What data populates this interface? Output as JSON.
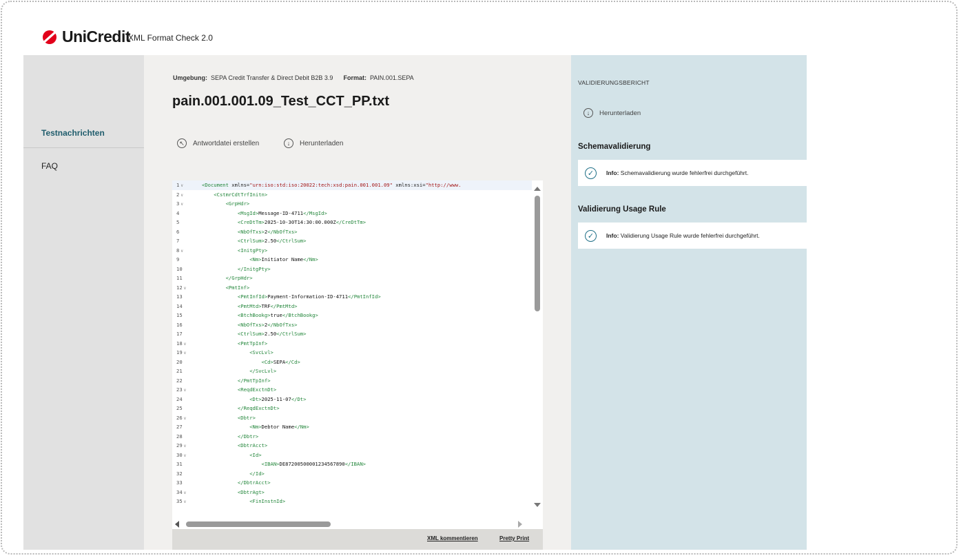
{
  "header": {
    "brand": "UniCredit",
    "app_title": "XML Format Check 2.0",
    "brand_color": "#e2001a"
  },
  "sidebar": {
    "items": [
      {
        "label": "Testnachrichten",
        "active": true
      },
      {
        "label": "FAQ",
        "active": false
      }
    ]
  },
  "main": {
    "environment_label": "Umgebung:",
    "environment_value": "SEPA Credit Transfer & Direct Debit B2B 3.9",
    "format_label": "Format:",
    "format_value": "PAIN.001.SEPA",
    "file_title": "pain.001.001.09_Test_CCT_PP.txt",
    "actions": {
      "reply_file": "Antwortdatei erstellen",
      "download": "Herunterladen"
    },
    "footer": {
      "comment": "XML kommentieren",
      "pretty_print": "Pretty Print"
    }
  },
  "editor": {
    "lines": [
      {
        "n": "1",
        "fold": true,
        "indent": 0,
        "text": "<Document xmlns=\"urn:iso:std:iso:20022:tech:xsd:pain.001.001.09\" xmlns:xsi=\"http://www."
      },
      {
        "n": "2",
        "fold": true,
        "indent": 1,
        "text": "<CstmrCdtTrfInitn>"
      },
      {
        "n": "3",
        "fold": true,
        "indent": 2,
        "text": "<GrpHdr>"
      },
      {
        "n": "4",
        "fold": false,
        "indent": 3,
        "text": "<MsgId>Message-ID-4711</MsgId>"
      },
      {
        "n": "5",
        "fold": false,
        "indent": 3,
        "text": "<CreDtTm>2025-10-30T14:30:00.000Z</CreDtTm>"
      },
      {
        "n": "6",
        "fold": false,
        "indent": 3,
        "text": "<NbOfTxs>2</NbOfTxs>"
      },
      {
        "n": "7",
        "fold": false,
        "indent": 3,
        "text": "<CtrlSum>2.50</CtrlSum>"
      },
      {
        "n": "8",
        "fold": true,
        "indent": 3,
        "text": "<InitgPty>"
      },
      {
        "n": "9",
        "fold": false,
        "indent": 4,
        "text": "<Nm>Initiator Name</Nm>"
      },
      {
        "n": "10",
        "fold": false,
        "indent": 3,
        "text": "</InitgPty>"
      },
      {
        "n": "11",
        "fold": false,
        "indent": 2,
        "text": "</GrpHdr>"
      },
      {
        "n": "12",
        "fold": true,
        "indent": 2,
        "text": "<PmtInf>"
      },
      {
        "n": "13",
        "fold": false,
        "indent": 3,
        "text": "<PmtInfId>Payment-Information-ID-4711</PmtInfId>"
      },
      {
        "n": "14",
        "fold": false,
        "indent": 3,
        "text": "<PmtMtd>TRF</PmtMtd>"
      },
      {
        "n": "15",
        "fold": false,
        "indent": 3,
        "text": "<BtchBookg>true</BtchBookg>"
      },
      {
        "n": "16",
        "fold": false,
        "indent": 3,
        "text": "<NbOfTxs>2</NbOfTxs>"
      },
      {
        "n": "17",
        "fold": false,
        "indent": 3,
        "text": "<CtrlSum>2.50</CtrlSum>"
      },
      {
        "n": "18",
        "fold": true,
        "indent": 3,
        "text": "<PmtTpInf>"
      },
      {
        "n": "19",
        "fold": true,
        "indent": 4,
        "text": "<SvcLvl>"
      },
      {
        "n": "20",
        "fold": false,
        "indent": 5,
        "text": "<Cd>SEPA</Cd>"
      },
      {
        "n": "21",
        "fold": false,
        "indent": 4,
        "text": "</SvcLvl>"
      },
      {
        "n": "22",
        "fold": false,
        "indent": 3,
        "text": "</PmtTpInf>"
      },
      {
        "n": "23",
        "fold": true,
        "indent": 3,
        "text": "<ReqdExctnDt>"
      },
      {
        "n": "24",
        "fold": false,
        "indent": 4,
        "text": "<Dt>2025-11-07</Dt>"
      },
      {
        "n": "25",
        "fold": false,
        "indent": 3,
        "text": "</ReqdExctnDt>"
      },
      {
        "n": "26",
        "fold": true,
        "indent": 3,
        "text": "<Dbtr>"
      },
      {
        "n": "27",
        "fold": false,
        "indent": 4,
        "text": "<Nm>Debtor Name</Nm>"
      },
      {
        "n": "28",
        "fold": false,
        "indent": 3,
        "text": "</Dbtr>"
      },
      {
        "n": "29",
        "fold": true,
        "indent": 3,
        "text": "<DbtrAcct>"
      },
      {
        "n": "30",
        "fold": true,
        "indent": 4,
        "text": "<Id>"
      },
      {
        "n": "31",
        "fold": false,
        "indent": 5,
        "text": "<IBAN>DE87200500001234567890</IBAN>"
      },
      {
        "n": "32",
        "fold": false,
        "indent": 4,
        "text": "</Id>"
      },
      {
        "n": "33",
        "fold": false,
        "indent": 3,
        "text": "</DbtrAcct>"
      },
      {
        "n": "34",
        "fold": true,
        "indent": 3,
        "text": "<DbtrAgt>"
      },
      {
        "n": "35",
        "fold": true,
        "indent": 4,
        "text": "<FinInstnId>"
      }
    ]
  },
  "report": {
    "title": "VALIDIERUNGSBERICHT",
    "download": "Herunterladen",
    "sections": [
      {
        "heading": "Schemavalidierung",
        "info_label": "Info:",
        "message": "Schemavalidierung wurde fehlerfrei durchgeführt."
      },
      {
        "heading": "Validierung Usage Rule",
        "info_label": "Info:",
        "message": "Validierung Usage Rule wurde fehlerfrei durchgeführt."
      }
    ]
  }
}
